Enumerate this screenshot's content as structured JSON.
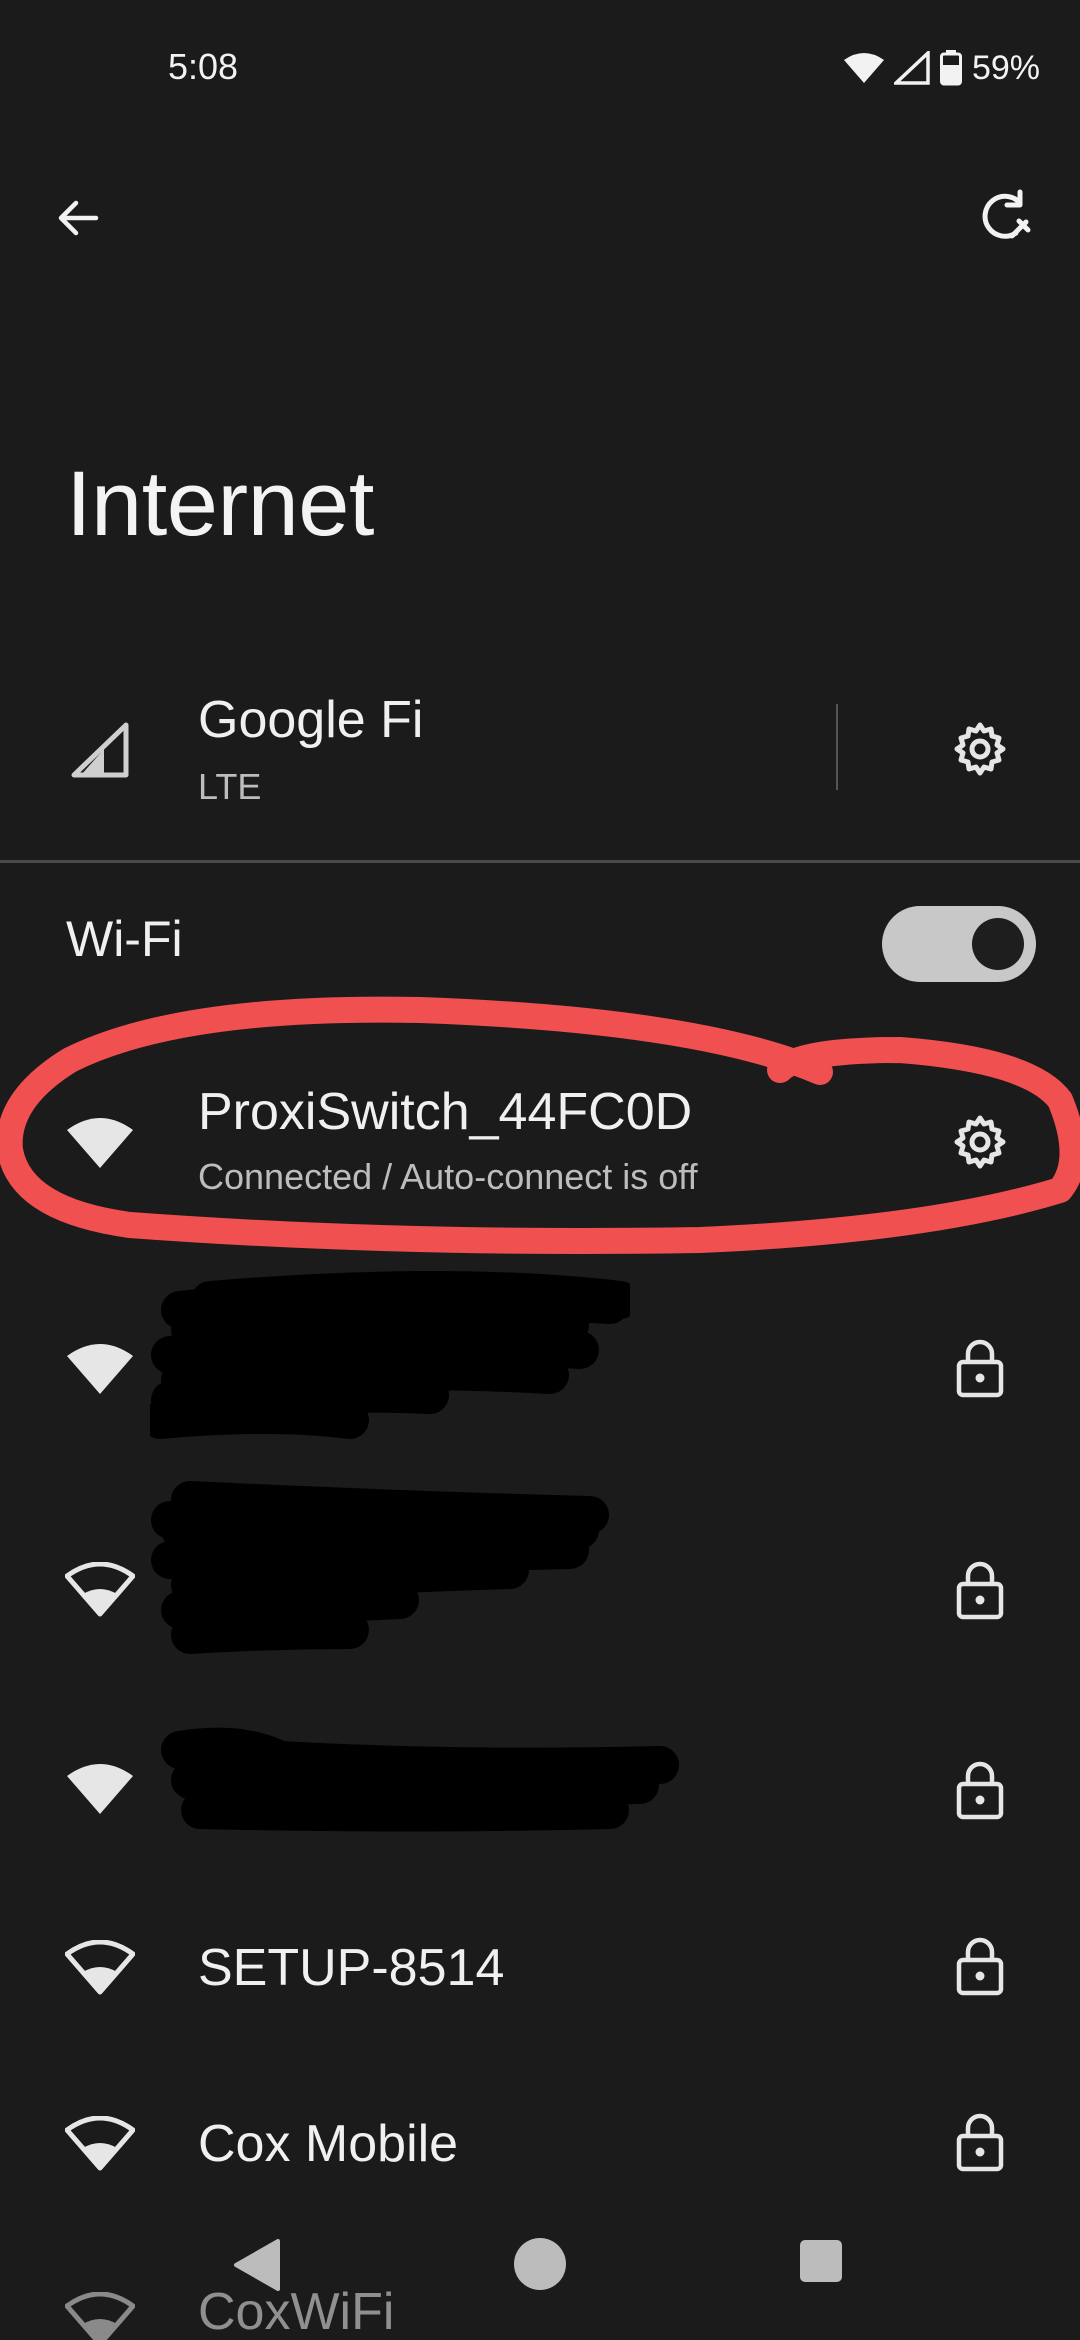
{
  "status_bar": {
    "time": "5:08",
    "battery_percent": "59%"
  },
  "app_bar": {
    "back_icon": "arrow-back-icon",
    "reset_icon": "network-reset-icon"
  },
  "page": {
    "title": "Internet"
  },
  "mobile_network": {
    "name": "Google Fi",
    "type": "LTE",
    "icon": "cell-signal-icon",
    "action_icon": "gear-icon"
  },
  "wifi": {
    "label": "Wi-Fi",
    "enabled": true
  },
  "networks": [
    {
      "name": "ProxiSwitch_44FC0D",
      "status": "Connected / Auto-connect is off",
      "signal": "full",
      "action": "gear-icon",
      "highlighted": true
    },
    {
      "name": "",
      "status": "",
      "signal": "full",
      "action": "lock-icon",
      "redacted": true
    },
    {
      "name": "",
      "status": "",
      "signal": "partial",
      "action": "lock-icon",
      "redacted": true
    },
    {
      "name": "",
      "status": "",
      "signal": "full",
      "action": "lock-icon",
      "redacted": true
    },
    {
      "name": "SETUP-8514",
      "status": "",
      "signal": "partial",
      "action": "lock-icon"
    },
    {
      "name": "Cox Mobile",
      "status": "",
      "signal": "partial",
      "action": "lock-icon"
    },
    {
      "name": "CoxWiFi",
      "status": "",
      "signal": "partial",
      "action": ""
    }
  ],
  "colors": {
    "background": "#1b1b1b",
    "highlight": "#f05050",
    "toggle_track": "#c8c8c8"
  }
}
